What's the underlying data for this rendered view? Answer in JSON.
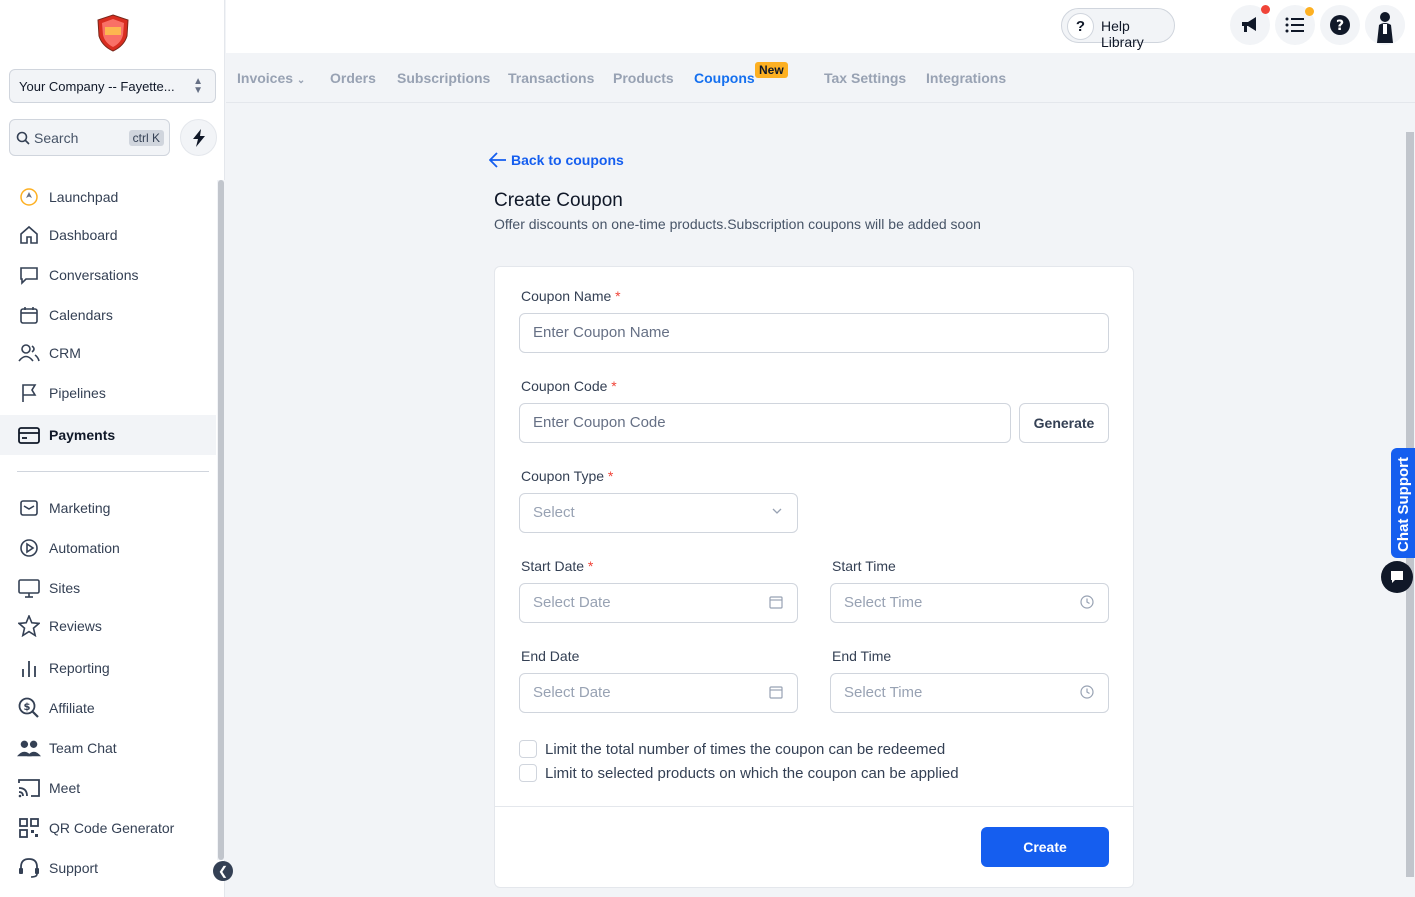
{
  "sidebar": {
    "company": "Your Company -- Fayette...",
    "search_placeholder": "Search",
    "search_shortcut": "ctrl K",
    "items_top": [
      {
        "label": "Launchpad",
        "icon": "rocket-icon"
      },
      {
        "label": "Dashboard",
        "icon": "home-icon"
      },
      {
        "label": "Conversations",
        "icon": "chat-icon"
      },
      {
        "label": "Calendars",
        "icon": "calendar-icon"
      },
      {
        "label": "CRM",
        "icon": "contacts-icon"
      },
      {
        "label": "Pipelines",
        "icon": "flag-icon"
      },
      {
        "label": "Payments",
        "icon": "payment-card-icon"
      }
    ],
    "items_bottom": [
      {
        "label": "Marketing",
        "icon": "mail-icon"
      },
      {
        "label": "Automation",
        "icon": "play-circle-icon"
      },
      {
        "label": "Sites",
        "icon": "monitor-icon"
      },
      {
        "label": "Reviews",
        "icon": "star-icon"
      },
      {
        "label": "Reporting",
        "icon": "bar-chart-icon"
      },
      {
        "label": "Affiliate",
        "icon": "dollar-search-icon"
      },
      {
        "label": "Team Chat",
        "icon": "team-icon"
      },
      {
        "label": "Meet",
        "icon": "cast-icon"
      },
      {
        "label": "QR Code Generator",
        "icon": "qr-icon"
      },
      {
        "label": "Support",
        "icon": "headset-icon"
      }
    ]
  },
  "topbar": {
    "help_label": "Help Library"
  },
  "tabs": [
    {
      "label": "Invoices"
    },
    {
      "label": "Orders"
    },
    {
      "label": "Subscriptions"
    },
    {
      "label": "Transactions"
    },
    {
      "label": "Products"
    },
    {
      "label": "Coupons",
      "active": true,
      "badge": "New"
    },
    {
      "label": "Tax Settings"
    },
    {
      "label": "Integrations"
    }
  ],
  "page": {
    "back_label": "Back to coupons",
    "title": "Create Coupon",
    "subtitle": "Offer discounts on one-time products.Subscription coupons will be added soon"
  },
  "form": {
    "coupon_name_label": "Coupon Name",
    "coupon_name_placeholder": "Enter Coupon Name",
    "coupon_code_label": "Coupon Code",
    "coupon_code_placeholder": "Enter Coupon Code",
    "generate_label": "Generate",
    "coupon_type_label": "Coupon Type",
    "coupon_type_placeholder": "Select",
    "start_date_label": "Start Date",
    "start_date_placeholder": "Select Date",
    "start_time_label": "Start Time",
    "start_time_placeholder": "Select Time",
    "end_date_label": "End Date",
    "end_date_placeholder": "Select Date",
    "end_time_label": "End Time",
    "end_time_placeholder": "Select Time",
    "limit_redeem_label": "Limit the total number of times the coupon can be redeemed",
    "limit_products_label": "Limit to selected products on which the coupon can be applied",
    "required_mark": "*",
    "create_label": "Create"
  },
  "chat_support_label": "Chat Support",
  "colors": {
    "accent": "#155eef",
    "badge": "#fdb022",
    "required": "#f04438"
  }
}
